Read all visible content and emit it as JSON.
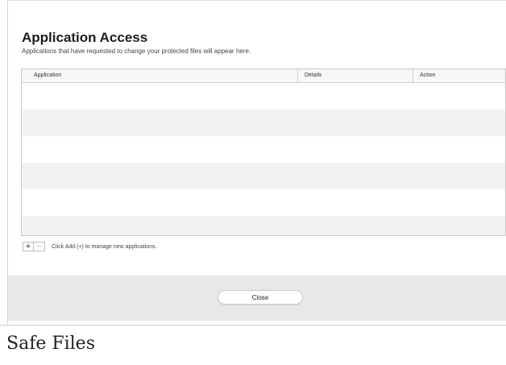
{
  "dialog": {
    "title": "Application Access",
    "subtitle": "Applications that have requested to change your protected files will appear here."
  },
  "table": {
    "columns": [
      "Application",
      "Details",
      "Action"
    ],
    "rows": []
  },
  "controls": {
    "add_symbol": "+",
    "remove_symbol": "−",
    "hint": "Click Add (+) to manage new applications."
  },
  "footer": {
    "close_label": "Close"
  },
  "caption": "Safe Files"
}
